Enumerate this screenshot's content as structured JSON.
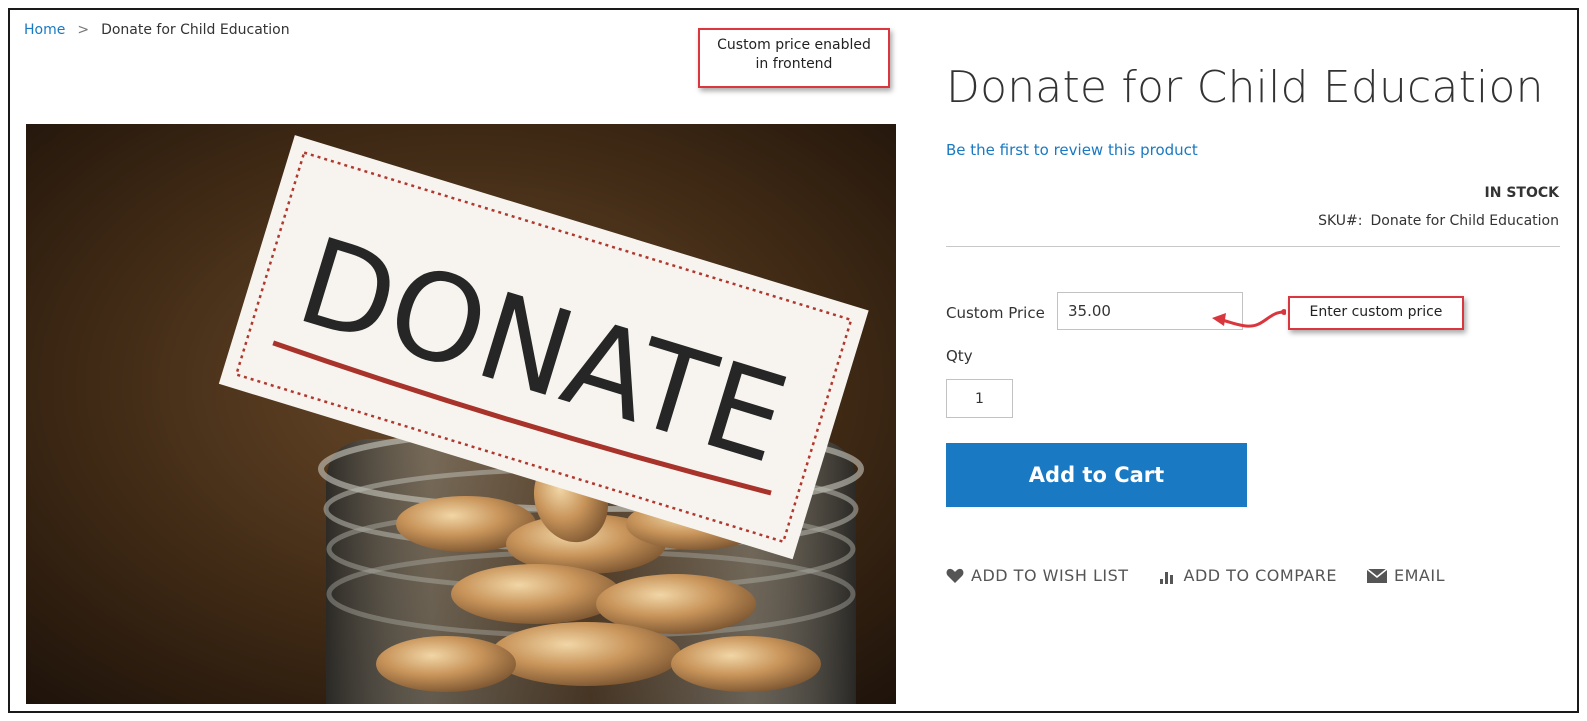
{
  "breadcrumb": {
    "home": "Home",
    "separator": ">",
    "current": "Donate for Child Education"
  },
  "annotations": {
    "callout_top_line1": "Custom price enabled",
    "callout_top_line2": "in frontend",
    "callout_input": "Enter custom price",
    "callout_border_color": "#d9363e"
  },
  "product": {
    "image_sign_text": "DONATE",
    "title": "Donate for Child Education",
    "review_link": "Be the first to review this product",
    "stock": "IN STOCK",
    "sku_label": "SKU#:",
    "sku_value": "Donate for Child Education"
  },
  "form": {
    "custom_price_label": "Custom Price",
    "custom_price_value": "35.00",
    "qty_label": "Qty",
    "qty_value": "1",
    "add_to_cart": "Add to Cart"
  },
  "actions": [
    {
      "icon": "heart-icon",
      "label": "ADD TO WISH LIST"
    },
    {
      "icon": "bar-chart-icon",
      "label": "ADD TO COMPARE"
    },
    {
      "icon": "envelope-icon",
      "label": "EMAIL"
    }
  ],
  "colors": {
    "accent": "#1979c3",
    "text": "#333333"
  }
}
